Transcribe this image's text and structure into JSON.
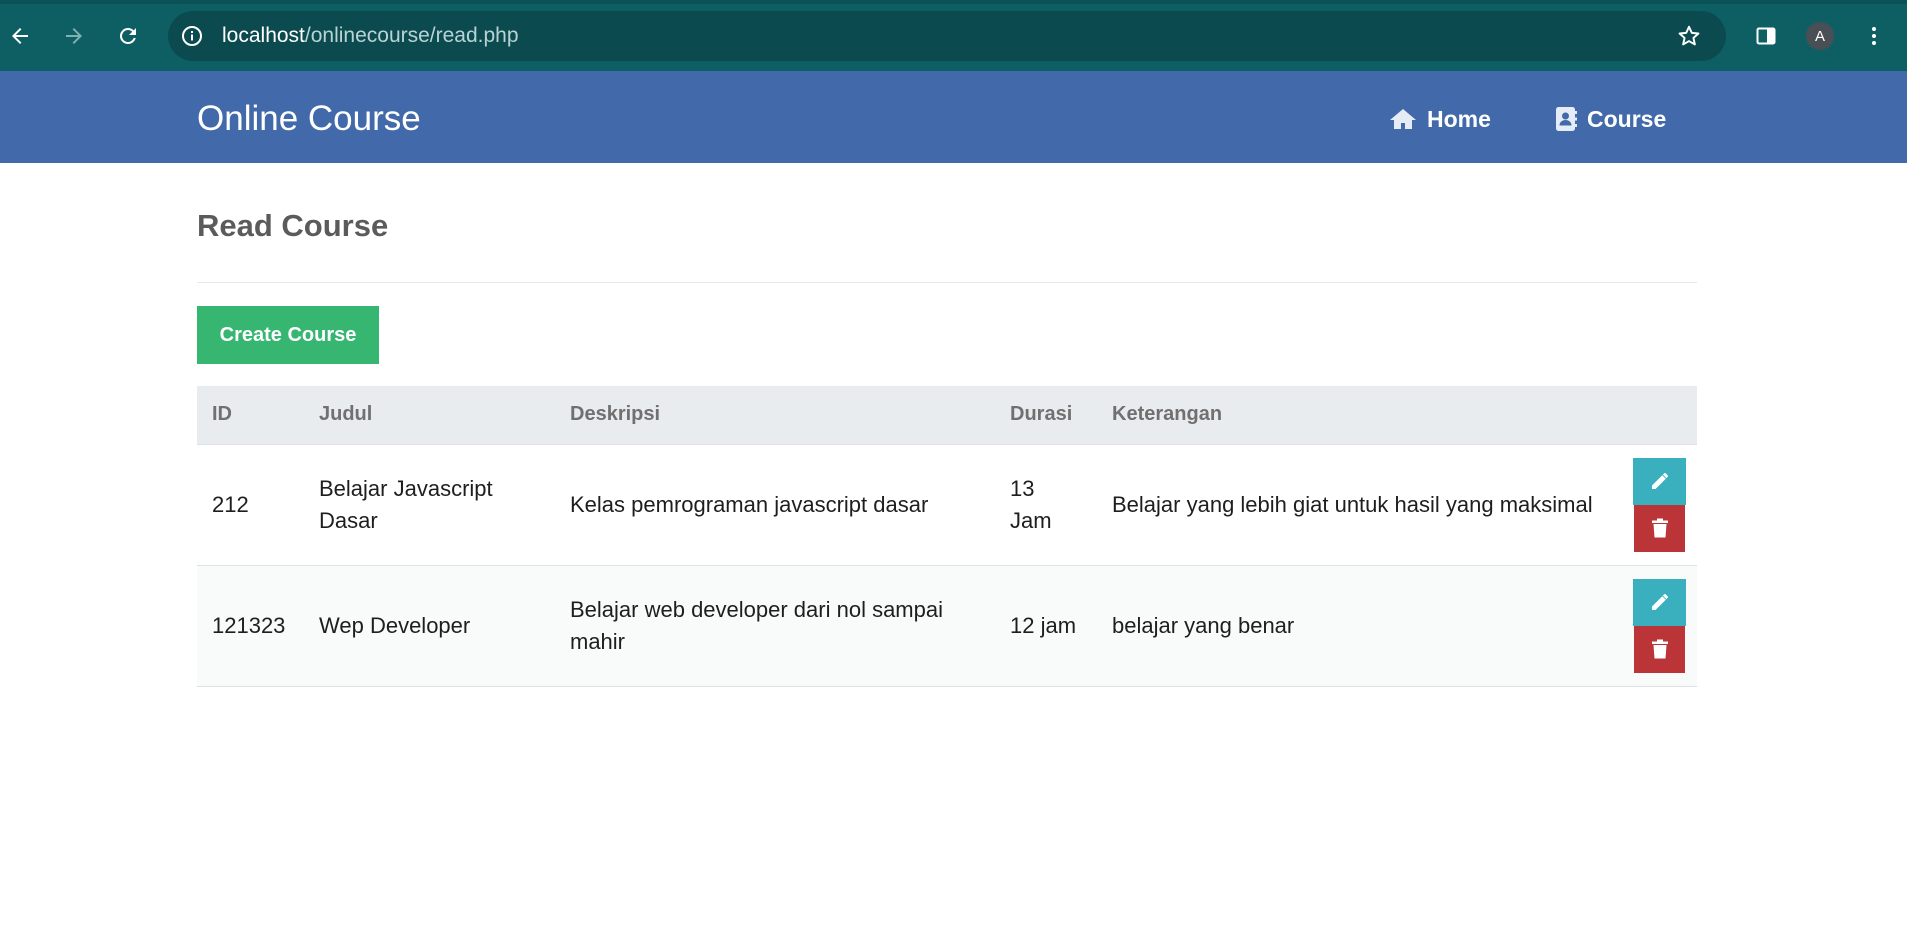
{
  "browser": {
    "url_host": "localhost",
    "url_path": "/onlinecourse/read.php",
    "profile_initial": "A",
    "icons": [
      "back-icon",
      "forward-icon",
      "reload-icon",
      "info-icon",
      "star-icon",
      "side-panel-icon",
      "menu-icon"
    ]
  },
  "navbar": {
    "brand": "Online Course",
    "links": [
      {
        "label": "Home",
        "icon": "home-icon"
      },
      {
        "label": "Course",
        "icon": "address-book-icon"
      }
    ],
    "color": "#426aaa"
  },
  "main": {
    "title": "Read Course",
    "create_button": "Create Course",
    "table": {
      "headers": [
        "ID",
        "Judul",
        "Deskripsi",
        "Durasi",
        "Keterangan"
      ],
      "rows": [
        {
          "id": "212",
          "judul": "Belajar Javascript Dasar",
          "deskripsi": "Kelas pemrograman javascript dasar",
          "durasi": "13 Jam",
          "keterangan": "Belajar yang lebih giat untuk hasil yang maksimal"
        },
        {
          "id": "121323",
          "judul": "Wep Developer",
          "deskripsi": "Belajar web developer dari nol sampai mahir",
          "durasi": "12 jam",
          "keterangan": "belajar yang benar"
        }
      ]
    }
  },
  "colors": {
    "create": "#37b671",
    "edit": "#3aafbd",
    "delete": "#bb3438"
  }
}
